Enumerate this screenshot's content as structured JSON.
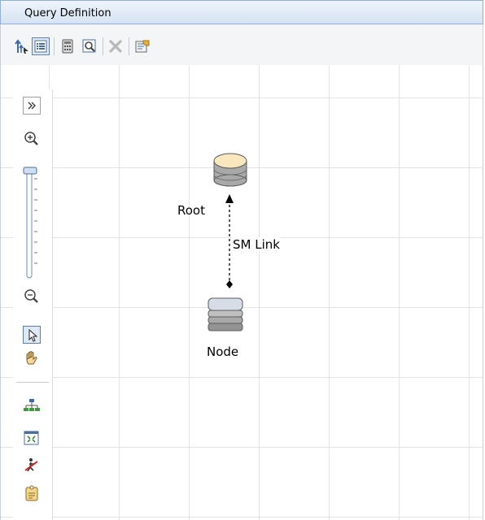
{
  "panel": {
    "title": "Query Definition"
  },
  "toolbar": {
    "buttons": [
      {
        "name": "navigate-up-icon"
      },
      {
        "name": "details-view-icon",
        "active": true
      },
      {
        "name": "calculator-icon"
      },
      {
        "name": "preview-icon"
      },
      {
        "name": "delete-icon",
        "disabled": true
      },
      {
        "name": "properties-icon"
      }
    ]
  },
  "diagram": {
    "nodes": [
      {
        "label": "Root",
        "icon": "database-root-icon"
      },
      {
        "label": "Node",
        "icon": "node-icon"
      }
    ],
    "links": [
      {
        "label": "SM Link",
        "from": "Node",
        "to": "Root"
      }
    ]
  },
  "side_panel": {
    "tools": [
      "expand-icon",
      "zoom-in-icon",
      "zoom-slider",
      "zoom-out-icon",
      "select-pointer-icon",
      "pan-hand-icon",
      "hierarchy-layout-icon",
      "fit-to-window-icon",
      "hide-element-icon",
      "tag-icon"
    ],
    "zoom_level": 1.0
  }
}
